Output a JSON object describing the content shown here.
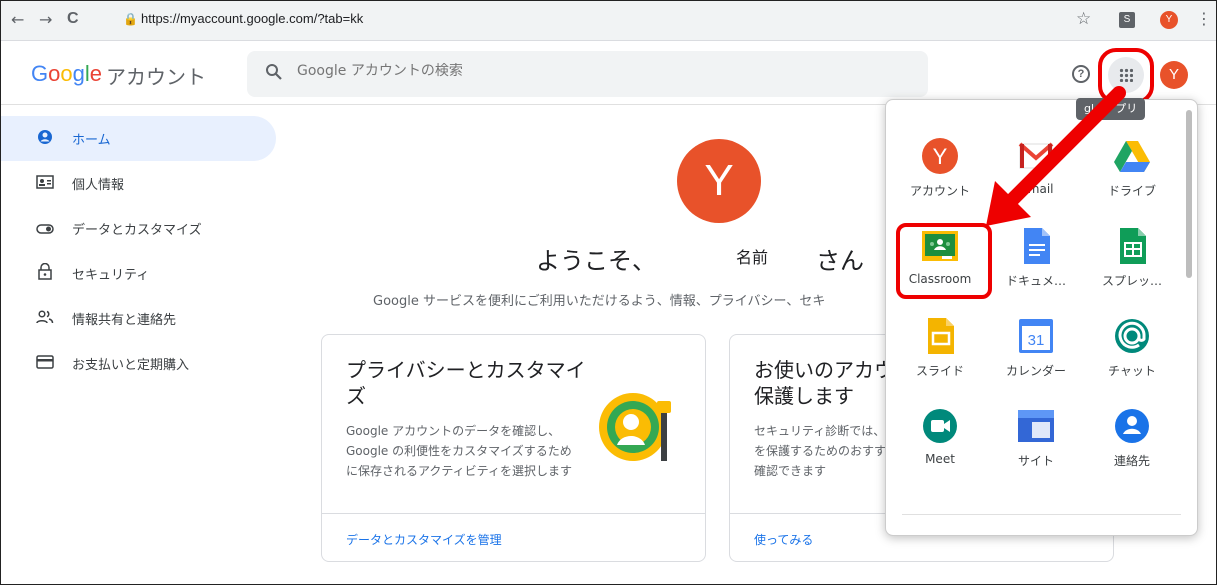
{
  "browser": {
    "url": "https://myaccount.google.com/?tab=kk",
    "back_glyph": "←",
    "forward_glyph": "→",
    "reload_glyph": "C",
    "ext1_label": "S",
    "profile_initial": "Y"
  },
  "header": {
    "logo_letters": [
      "G",
      "o",
      "o",
      "g",
      "l",
      "e"
    ],
    "product_name": "アカウント",
    "search_placeholder": "Google アカウントの検索",
    "help_glyph": "?",
    "avatar_initial": "Y",
    "apps_tooltip": "gle アプリ"
  },
  "sidebar": {
    "items": [
      {
        "label": "ホーム",
        "icon": "account-circle-icon",
        "active": true
      },
      {
        "label": "個人情報",
        "icon": "id-card-icon"
      },
      {
        "label": "データとカスタマイズ",
        "icon": "toggle-icon"
      },
      {
        "label": "セキュリティ",
        "icon": "lock-icon"
      },
      {
        "label": "情報共有と連絡先",
        "icon": "people-icon"
      },
      {
        "label": "お支払いと定期購入",
        "icon": "credit-card-icon"
      }
    ]
  },
  "main": {
    "avatar_initial": "Y",
    "welcome_prefix": "ようこそ、",
    "welcome_name": "名前",
    "welcome_suffix": "さん",
    "subtitle": "Google サービスを便利にご利用いただけるよう、情報、プライバシー、セキ",
    "cards": [
      {
        "title": "プライバシーとカスタマイズ",
        "text": "Google アカウントのデータを確認し、Google の利便性をカスタマイズするために保存されるアクティビティを選択します",
        "link": "データとカスタマイズを管理"
      },
      {
        "title": "お使いのアカウントを保護します",
        "text": "セキュリティ診断では、アカウントを保護するためのおすすめの方法を確認できます",
        "link": "使ってみる"
      }
    ]
  },
  "apps_panel": {
    "apps": [
      {
        "label": "アカウント",
        "icon": "account-app-icon"
      },
      {
        "label": "Gmail",
        "icon": "gmail-icon"
      },
      {
        "label": "ドライブ",
        "icon": "drive-icon"
      },
      {
        "label": "Classroom",
        "icon": "classroom-icon"
      },
      {
        "label": "ドキュメ…",
        "icon": "docs-icon"
      },
      {
        "label": "スプレッ…",
        "icon": "sheets-icon"
      },
      {
        "label": "スライド",
        "icon": "slides-icon"
      },
      {
        "label": "カレンダー",
        "icon": "calendar-icon"
      },
      {
        "label": "チャット",
        "icon": "chat-icon"
      },
      {
        "label": "Meet",
        "icon": "meet-icon"
      },
      {
        "label": "サイト",
        "icon": "sites-icon"
      },
      {
        "label": "連絡先",
        "icon": "contacts-icon"
      }
    ],
    "account_initial": "Y",
    "calendar_day": "31"
  },
  "colors": {
    "accent": "#1a73e8",
    "avatar": "#e8522a",
    "highlight": "#ee0000",
    "active_nav_bg": "#e8f0fe"
  }
}
